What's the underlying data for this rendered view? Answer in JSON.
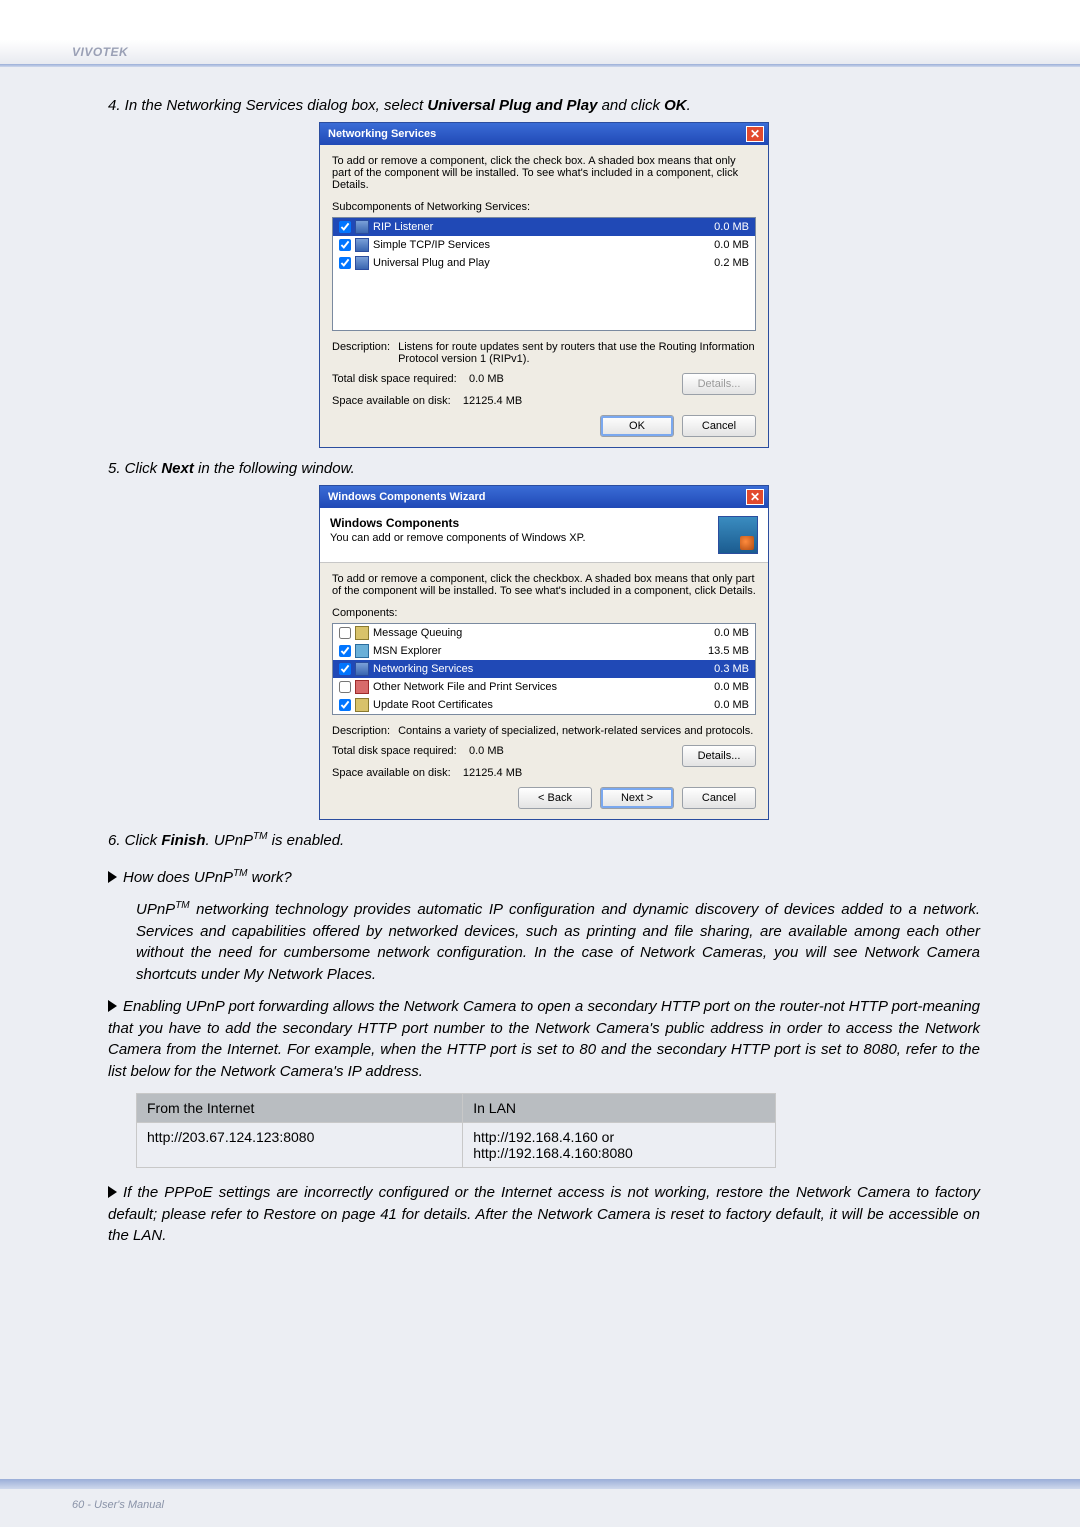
{
  "header": {
    "brand": "VIVOTEK"
  },
  "steps": {
    "s4": {
      "prefix": "4. In the Networking Services dialog box, select ",
      "b1": "Universal Plug and Play",
      "mid": " and click ",
      "b2": "OK",
      "suffix": "."
    },
    "s5": {
      "prefix": "5. Click ",
      "b1": "Next",
      "suffix": " in the following window."
    },
    "s6": {
      "prefix": "6. Click ",
      "b1": "Finish",
      "mid": ". UPnP",
      "sup": "TM",
      "suffix": " is enabled."
    }
  },
  "dlg1": {
    "title": "Networking Services",
    "hint": "To add or remove a component, click the check box. A shaded box means that only part of the component will be installed. To see what's included in a component, click Details.",
    "sub_label": "Subcomponents of Networking Services:",
    "items": [
      {
        "name": "RIP Listener",
        "size": "0.0 MB"
      },
      {
        "name": "Simple TCP/IP Services",
        "size": "0.0 MB"
      },
      {
        "name": "Universal Plug and Play",
        "size": "0.2 MB"
      }
    ],
    "desc_label": "Description:",
    "desc_text": "Listens for route updates sent by routers that use the Routing Information Protocol version 1 (RIPv1).",
    "req_label": "Total disk space required:",
    "req_value": "0.0 MB",
    "avail_label": "Space available on disk:",
    "avail_value": "12125.4 MB",
    "details_btn": "Details...",
    "ok": "OK",
    "cancel": "Cancel"
  },
  "dlg2": {
    "title": "Windows Components Wizard",
    "heading": "Windows Components",
    "subheading": "You can add or remove components of Windows XP.",
    "hint": "To add or remove a component, click the checkbox. A shaded box means that only part of the component will be installed. To see what's included in a component, click Details.",
    "comp_label": "Components:",
    "items": [
      {
        "name": "Message Queuing",
        "size": "0.0 MB"
      },
      {
        "name": "MSN Explorer",
        "size": "13.5 MB"
      },
      {
        "name": "Networking Services",
        "size": "0.3 MB"
      },
      {
        "name": "Other Network File and Print Services",
        "size": "0.0 MB"
      },
      {
        "name": "Update Root Certificates",
        "size": "0.0 MB"
      }
    ],
    "desc_label": "Description:",
    "desc_text": "Contains a variety of specialized, network-related services and protocols.",
    "req_label": "Total disk space required:",
    "req_value": "0.0 MB",
    "avail_label": "Space available on disk:",
    "avail_value": "12125.4 MB",
    "details_btn": "Details...",
    "back": "< Back",
    "next": "Next >",
    "cancel": "Cancel"
  },
  "faqs": {
    "q1": {
      "q_pre": "How does UPnP",
      "sup": "TM",
      "q_post": " work?",
      "a_pre": "UPnP",
      "a_post": " networking technology provides automatic IP configuration and dynamic discovery of devices added to a network. Services and capabilities offered by networked devices, such as printing and file sharing, are available among each other without the need for cumbersome network configuration. In the case of Network Cameras, you will see Network Camera shortcuts under My Network Places."
    },
    "q2": {
      "text": "Enabling UPnP port forwarding allows the Network Camera to open a secondary HTTP port on the router-not HTTP port-meaning that you have to add the secondary HTTP port number to the Network Camera's public address in order to access the Network Camera from the Internet. For example, when the HTTP port is set to 80 and the secondary HTTP port is set to 8080, refer to the list below for the Network Camera's IP address."
    },
    "q3": {
      "text": "If the PPPoE settings are incorrectly configured or the Internet access is not working, restore the Network Camera to factory default; please refer to Restore on page 41 for details. After the Network Camera is reset to factory default, it will be accessible on the LAN."
    }
  },
  "table": {
    "head": [
      "From the Internet",
      "In LAN"
    ],
    "rows": [
      {
        "0": "http://203.67.124.123:8080",
        "1a": "http://192.168.4.160 or",
        "1b": "http://192.168.4.160:8080"
      }
    ]
  },
  "footer": {
    "text": "60 - User's Manual"
  }
}
